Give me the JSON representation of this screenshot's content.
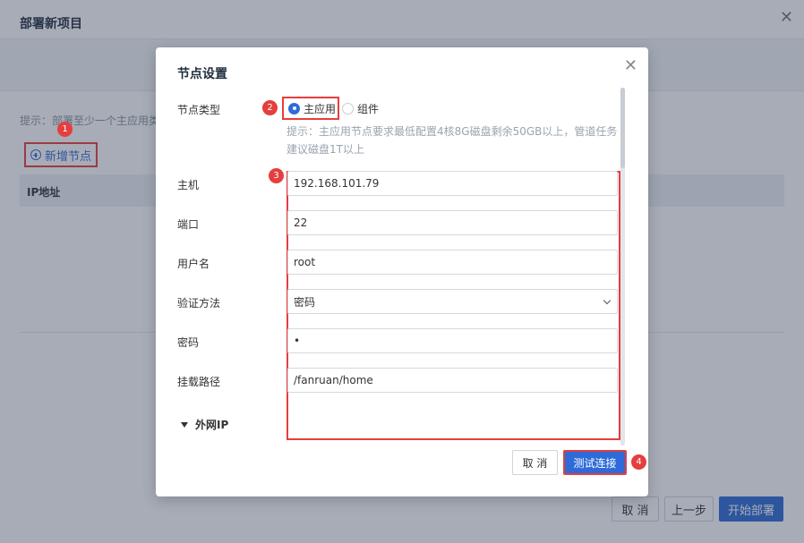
{
  "background": {
    "title": "部署新项目",
    "tip": "提示：部署至少一个主应用类",
    "add_node": "新增节点",
    "table_header_ip": "IP地址",
    "btn_cancel": "取 消",
    "btn_prev": "上一步",
    "btn_deploy": "开始部署"
  },
  "modal": {
    "title": "节点设置",
    "node_type_label": "节点类型",
    "radio_main": "主应用",
    "radio_component": "组件",
    "hint": "提示：主应用节点要求最低配置4核8G磁盘剩余50GB以上，管道任务建议磁盘1T以上",
    "fields": {
      "host_label": "主机",
      "host_value": "192.168.101.79",
      "port_label": "端口",
      "port_value": "22",
      "user_label": "用户名",
      "user_value": "root",
      "auth_label": "验证方法",
      "auth_value": "密码",
      "password_label": "密码",
      "password_value": "•",
      "mount_label": "挂载路径",
      "mount_value": "/fanruan/home"
    },
    "external_ip_label": "外网IP",
    "btn_cancel": "取 消",
    "btn_test": "测试连接"
  },
  "badges": [
    "1",
    "2",
    "3",
    "4"
  ],
  "colors": {
    "primary": "#2f6bd8",
    "highlight": "#e53e3e"
  }
}
